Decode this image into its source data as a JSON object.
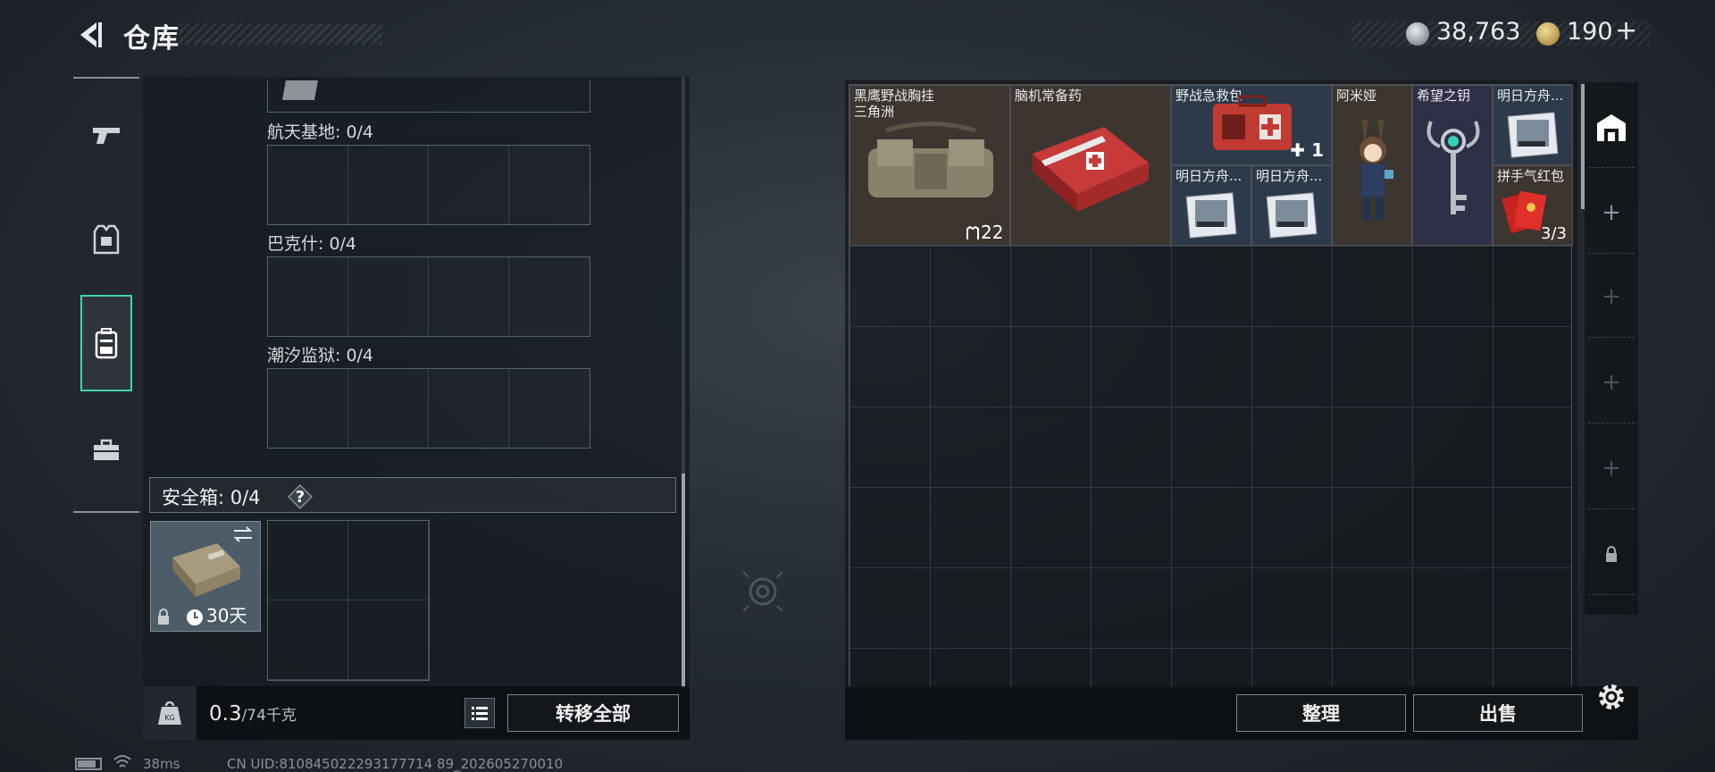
{
  "header": {
    "title": "仓库",
    "currency": [
      {
        "icon": "silver-coin-icon",
        "value": "38,763"
      },
      {
        "icon": "gold-coin-icon",
        "value": "190"
      }
    ],
    "add_symbol": "+"
  },
  "nav": {
    "items": [
      {
        "icon": "gun-icon",
        "active": false
      },
      {
        "icon": "armor-vest-icon",
        "active": false
      },
      {
        "icon": "backpack-icon",
        "active": true
      },
      {
        "icon": "toolbox-icon",
        "active": false
      }
    ],
    "accent": "#3dd6a8"
  },
  "left_panel": {
    "maps": [
      {
        "label": "航天基地: 0/4"
      },
      {
        "label": "巴克什: 0/4"
      },
      {
        "label": "潮汐监狱: 0/4"
      }
    ],
    "safe_box": {
      "label": "安全箱: 0/4",
      "help": "?",
      "item_duration": "30天"
    },
    "weight": {
      "current": "0.3",
      "max": "/74千克"
    },
    "transfer_all": "转移全部"
  },
  "stash": {
    "items": [
      {
        "name": "黑鹰野战胸挂",
        "subtitle": "三角洲",
        "count": "22",
        "icon": "chest-rig-icon"
      },
      {
        "name": "脑机常备药",
        "icon": "medkit-icon"
      },
      {
        "name": "野战急救包",
        "count": "1",
        "icon": "first-aid-kit-icon"
      },
      {
        "name": "阿米娅",
        "icon": "figurine-icon"
      },
      {
        "name": "希望之钥",
        "icon": "key-icon"
      },
      {
        "name": "明日方舟...",
        "icon": "album-icon"
      },
      {
        "name": "明日方舟...",
        "icon": "album-icon"
      },
      {
        "name": "明日方舟...",
        "icon": "album-icon"
      },
      {
        "name": "拼手气红包",
        "count": "3/3",
        "icon": "red-envelope-icon"
      }
    ],
    "sort_button": "整理",
    "sell_button": "出售"
  },
  "status_bar": {
    "ping": "38ms",
    "uid": "CN UID:810845022293177714 89_202605270010"
  }
}
